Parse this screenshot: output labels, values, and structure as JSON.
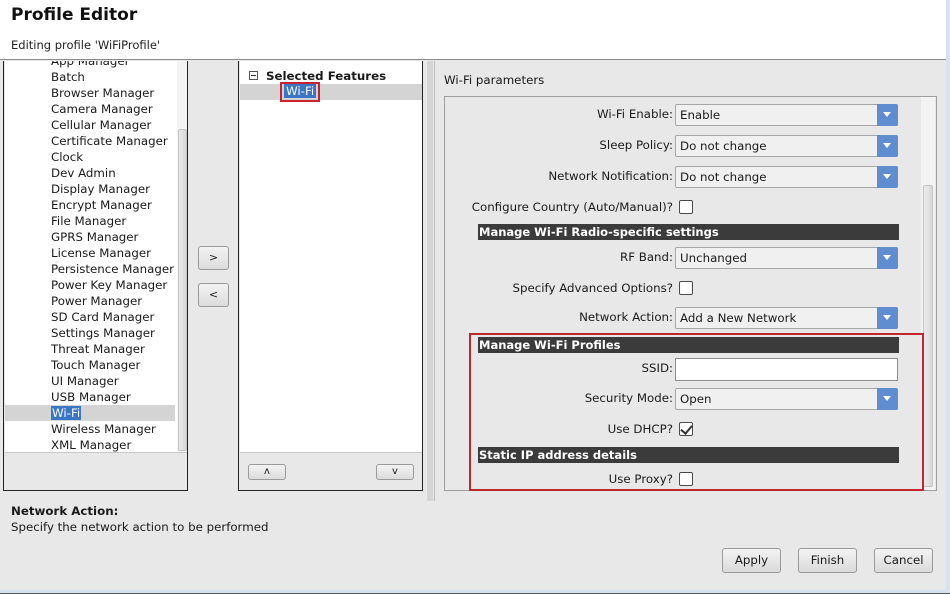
{
  "header": {
    "title": "Profile Editor",
    "subtitle": "Editing profile 'WiFiProfile'"
  },
  "available_features": {
    "items": [
      {
        "label": "App Manager",
        "selected": false
      },
      {
        "label": "Batch",
        "selected": false
      },
      {
        "label": "Browser Manager",
        "selected": false
      },
      {
        "label": "Camera Manager",
        "selected": false
      },
      {
        "label": "Cellular Manager",
        "selected": false
      },
      {
        "label": "Certificate Manager",
        "selected": false
      },
      {
        "label": "Clock",
        "selected": false
      },
      {
        "label": "Dev Admin",
        "selected": false
      },
      {
        "label": "Display Manager",
        "selected": false
      },
      {
        "label": "Encrypt Manager",
        "selected": false
      },
      {
        "label": "File Manager",
        "selected": false
      },
      {
        "label": "GPRS Manager",
        "selected": false
      },
      {
        "label": "License Manager",
        "selected": false
      },
      {
        "label": "Persistence Manager",
        "selected": false
      },
      {
        "label": "Power Key Manager",
        "selected": false
      },
      {
        "label": "Power Manager",
        "selected": false
      },
      {
        "label": "SD Card Manager",
        "selected": false
      },
      {
        "label": "Settings Manager",
        "selected": false
      },
      {
        "label": "Threat Manager",
        "selected": false
      },
      {
        "label": "Touch Manager",
        "selected": false
      },
      {
        "label": "UI Manager",
        "selected": false
      },
      {
        "label": "USB Manager",
        "selected": false
      },
      {
        "label": "Wi-Fi",
        "selected": true
      },
      {
        "label": "Wireless Manager",
        "selected": false
      },
      {
        "label": "XML Manager",
        "selected": false
      }
    ]
  },
  "move_buttons": {
    "add": ">",
    "remove": "<"
  },
  "selected_features": {
    "header": "Selected Features",
    "items": [
      {
        "label": "Wi-Fi",
        "selected": true
      }
    ],
    "up": "ʌ",
    "down": "v"
  },
  "params": {
    "title": "Wi-Fi parameters",
    "wifi_enable": {
      "label": "Wi-Fi Enable:",
      "value": "Enable"
    },
    "sleep_policy": {
      "label": "Sleep Policy:",
      "value": "Do not change"
    },
    "network_notification": {
      "label": "Network Notification:",
      "value": "Do not change"
    },
    "configure_country": {
      "label": "Configure Country (Auto/Manual)?",
      "checked": false
    },
    "section_radio": "Manage Wi-Fi Radio-specific settings",
    "rf_band": {
      "label": "RF Band:",
      "value": "Unchanged"
    },
    "advanced_options": {
      "label": "Specify Advanced Options?",
      "checked": false
    },
    "network_action": {
      "label": "Network Action:",
      "value": "Add a New Network"
    },
    "section_profiles": "Manage Wi-Fi Profiles",
    "ssid": {
      "label": "SSID:",
      "value": ""
    },
    "security_mode": {
      "label": "Security Mode:",
      "value": "Open"
    },
    "use_dhcp": {
      "label": "Use DHCP?",
      "checked": true
    },
    "section_static_ip": "Static IP address details",
    "use_proxy": {
      "label": "Use Proxy?",
      "checked": false
    }
  },
  "help": {
    "title": "Network Action:",
    "text": "Specify the network action to be performed"
  },
  "buttons": {
    "apply": "Apply",
    "finish": "Finish",
    "cancel": "Cancel"
  },
  "colors": {
    "selection": "#3a76c4",
    "highlight": "#c0272d",
    "dropdown_arrow": "#5f8dd0",
    "section_bar": "#3b3b3b"
  }
}
